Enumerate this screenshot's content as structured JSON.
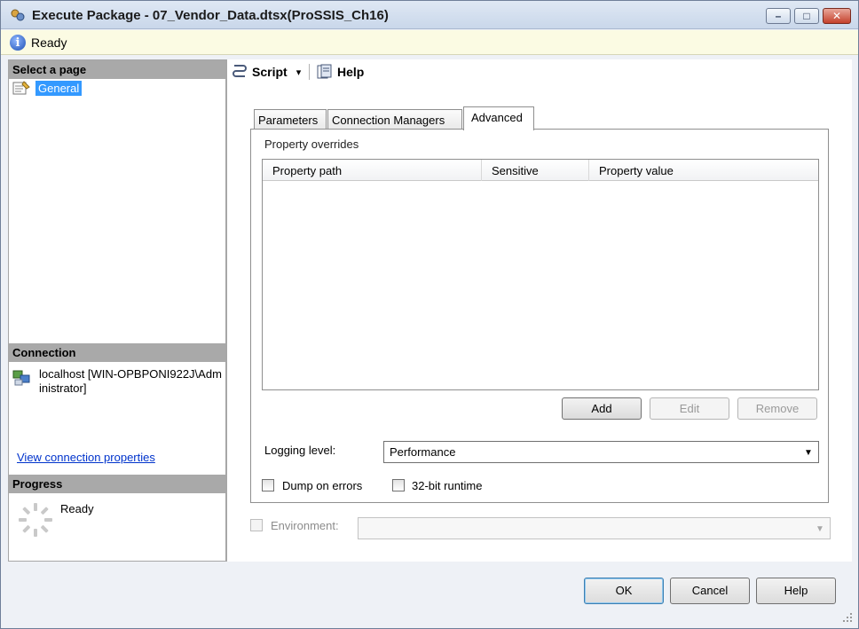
{
  "window": {
    "title": "Execute Package - 07_Vendor_Data.dtsx(ProSSIS_Ch16)",
    "minimize_glyph": "–",
    "maximize_glyph": "□",
    "close_glyph": "✕"
  },
  "status": {
    "text": "Ready"
  },
  "left": {
    "select_page_header": "Select a page",
    "pages": [
      {
        "label": "General",
        "selected": true
      }
    ],
    "connection_header": "Connection",
    "connection_text": "localhost [WIN-OPBPONI922J\\Administrator]",
    "connection_link": "View connection properties",
    "progress_header": "Progress",
    "progress_status": "Ready"
  },
  "toolbar": {
    "script_label": "Script",
    "script_dropdown_glyph": "▾",
    "help_label": "Help"
  },
  "tabs": [
    {
      "label": "Parameters",
      "active": false
    },
    {
      "label": "Connection Managers",
      "active": false
    },
    {
      "label": "Advanced",
      "active": true
    }
  ],
  "advanced": {
    "group_label": "Property overrides",
    "columns": [
      "Property path",
      "Sensitive",
      "Property value"
    ],
    "rows": [],
    "add_label": "Add",
    "edit_label": "Edit",
    "remove_label": "Remove",
    "logging_label": "Logging level:",
    "logging_value": "Performance",
    "dump_on_errors_label": "Dump on errors",
    "dump_on_errors_checked": false,
    "runtime_32bit_label": "32-bit runtime",
    "runtime_32bit_checked": false
  },
  "environment": {
    "label": "Environment:",
    "value": ""
  },
  "dialog_buttons": {
    "ok": "OK",
    "cancel": "Cancel",
    "help": "Help"
  },
  "colors": {
    "selection": "#3399ff",
    "link": "#0033cc",
    "status_bg": "#fbfbe3",
    "section_header": "#a9a9a9"
  }
}
